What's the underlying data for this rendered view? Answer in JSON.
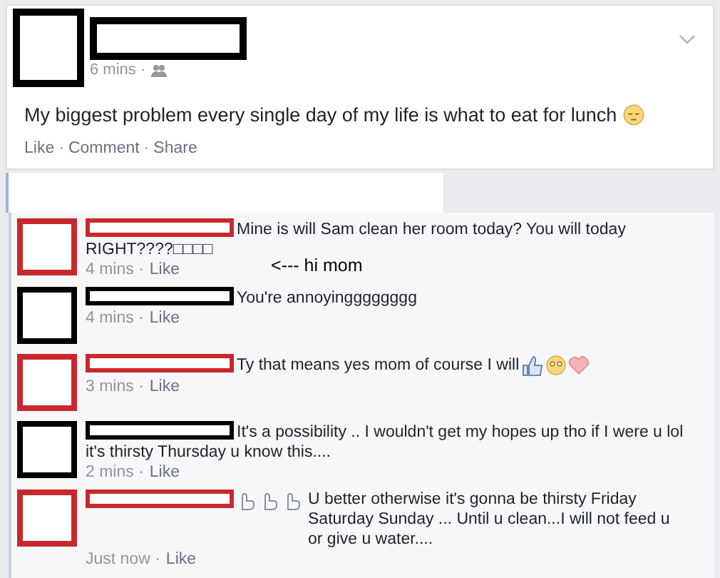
{
  "post": {
    "color": "#000000",
    "time": "6 mins ·",
    "text": "My biggest problem every single day of my life is what to eat for lunch",
    "actions": [
      {
        "kind": "link",
        "label": "Like"
      },
      {
        "kind": "separator",
        "label": "·"
      },
      {
        "kind": "link",
        "label": "Comment"
      },
      {
        "kind": "separator",
        "label": "·"
      },
      {
        "kind": "link",
        "label": "Share"
      }
    ]
  },
  "comments": [
    {
      "color": "#c8282d",
      "text": "Mine is will Sam clean her room today? You will today RIGHT????□□□□",
      "time": "4 mins ·",
      "action": "Like",
      "annotation": "<--- hi mom"
    },
    {
      "color": "#000000",
      "text": "You're annoyingggggggg",
      "time": "4 mins ·",
      "action": "Like"
    },
    {
      "color": "#c8282d",
      "text": "Ty that means yes mom of course I will",
      "time": "3 mins ·",
      "action": "Like"
    },
    {
      "color": "#000000",
      "text": "It's a possibility .. I wouldn't get my hopes up tho if I were u lol it's thirsty Thursday u know this....",
      "time": "2 mins ·",
      "action": "Like"
    },
    {
      "color": "#c8282d",
      "text": "U better otherwise it's gonna be thirsty Friday Saturday Sunday ... Until u clean...I will not feed u or give u water....",
      "time": "Just now ·",
      "action": "Like"
    }
  ]
}
